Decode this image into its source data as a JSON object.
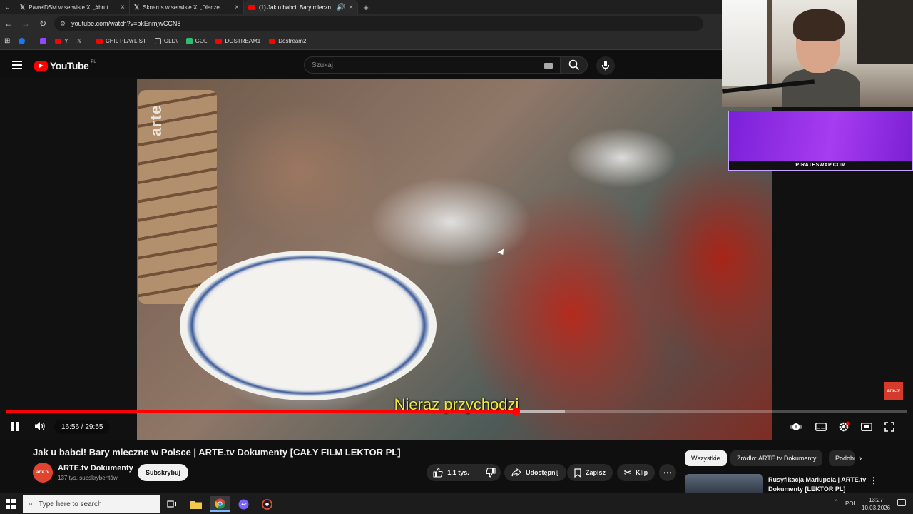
{
  "browser": {
    "tabs": [
      {
        "title": "PawelDSM w serwisie X: „#brut",
        "favicon": "x-logo",
        "active": false
      },
      {
        "title": "Sknerus w serwisie X: „Dlacze",
        "favicon": "x-logo",
        "active": false
      },
      {
        "title": "(1) Jak u babci! Bary mleczn",
        "favicon": "youtube-logo",
        "active": true
      }
    ],
    "url": "youtube.com/watch?v=bkEnmjwCCN8",
    "bookmarks": [
      {
        "label": "F",
        "icon": "facebook",
        "color": "#1877f2"
      },
      {
        "label": "",
        "icon": "twitch",
        "color": "#9146ff"
      },
      {
        "label": "Y",
        "icon": "youtube",
        "color": "#ff0000"
      },
      {
        "label": "T",
        "icon": "x",
        "color": "#ffffff"
      },
      {
        "label": "CHIL PLAYLIST",
        "icon": "youtube",
        "color": "#ff0000"
      },
      {
        "label": "OLD\\",
        "icon": "folder",
        "color": "#bbbbbb"
      },
      {
        "label": "GOL",
        "icon": "gol",
        "color": "#2bbf6f"
      },
      {
        "label": "DOSTREAM1",
        "icon": "youtube",
        "color": "#ff0000"
      },
      {
        "label": "Dostream2",
        "icon": "youtube",
        "color": "#ff0000"
      }
    ]
  },
  "youtube": {
    "logo_text": "YouTube",
    "country": "PL",
    "search_placeholder": "Szukaj"
  },
  "player": {
    "watermark": "arte",
    "subtitle": "Nieraz przychodzi",
    "time_current": "16:56",
    "time_total": "29:55",
    "time_display": "16:56 / 29:55",
    "progress_fraction": 0.566,
    "buffered_fraction": 0.62,
    "badge": "arte.tv"
  },
  "overlay": {
    "banner_text": "PIRATESWAP.COM"
  },
  "video": {
    "title": "Jak u babci! Bary mleczne w Polsce | ARTE.tv Dokumenty [CAŁY FILM LEKTOR PL]",
    "channel": "ARTE.tv Dokumenty",
    "avatar_text": "arte.tv",
    "subscribers": "137 tys. subskrybentów",
    "subscribe_label": "Subskrybuj",
    "likes": "1,1 tys.",
    "share_label": "Udostępnij",
    "save_label": "Zapisz",
    "clip_label": "Klip"
  },
  "sidebar": {
    "chips": [
      "Wszystkie",
      "Źródło: ARTE.tv Dokumenty",
      "Podobne"
    ],
    "rec_title": "Rusyfikacja Mariupola | ARTE.tv Dokumenty [LEKTOR PL]"
  },
  "taskbar": {
    "search_placeholder": "Type here to search",
    "lang": "POL",
    "time": "13:27",
    "date": "10.03.2026"
  }
}
